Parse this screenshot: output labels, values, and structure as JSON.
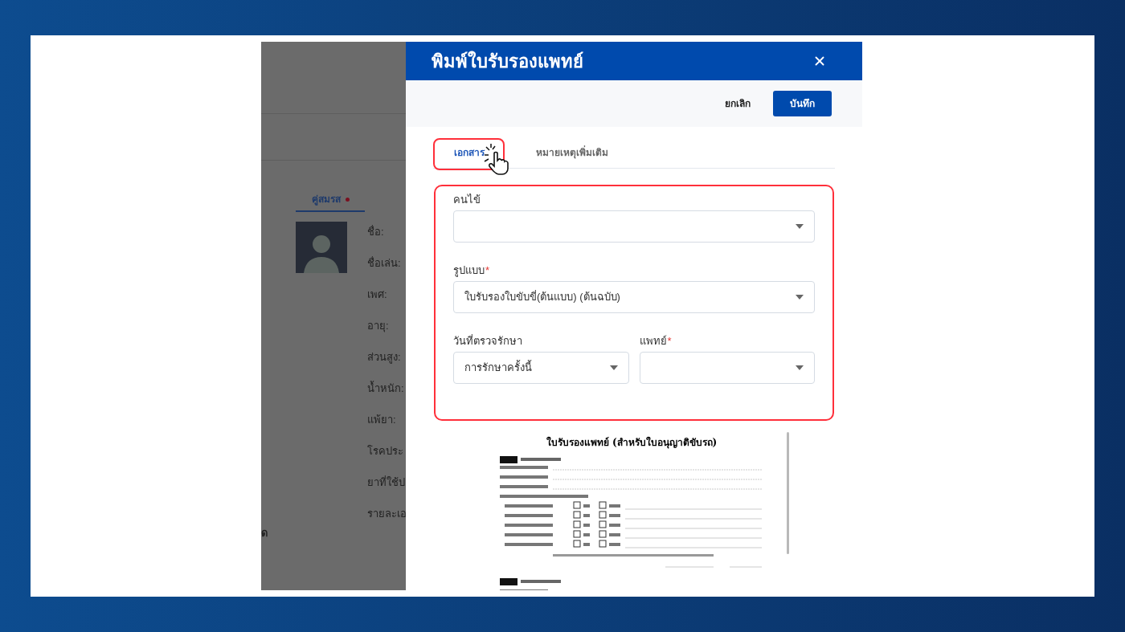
{
  "background_page": {
    "tab": {
      "label": "คู่สมรส",
      "selected": true
    },
    "profile_labels": [
      "ชื่อ:",
      "ชื่อเล่น:",
      "เพศ:",
      "อายุ:",
      "ส่วนสูง:",
      "น้ำหนัก:",
      "แพ้ยา:",
      "โรคประ",
      "ยาที่ใช้ป",
      "รายละเอ"
    ],
    "cut_text": "ด"
  },
  "dialog": {
    "title": "พิมพ์ใบรับรองแพทย์",
    "required_mark": "*",
    "actions": [
      {
        "label": "ยกเลิก",
        "kind": "text"
      },
      {
        "label": "บันทึก",
        "kind": "primary"
      }
    ],
    "tabs": [
      {
        "label": "เอกสาร",
        "selected": true,
        "highlighted": true
      },
      {
        "label": "หมายเหตุเพิ่มเติม",
        "selected": false,
        "highlighted": false
      }
    ],
    "fields": [
      {
        "label": "คนไข้",
        "required": false,
        "kind": "full"
      },
      {
        "label": "รูปแบบ",
        "required": true,
        "kind": "full",
        "value": "ใบรับรองใบขับขี่(ต้นแบบ) (ต้นฉบับ)"
      },
      {
        "label": "วันที่ตรวจรักษา",
        "required": false,
        "kind": "half",
        "value": "การรักษาครั้งนี้"
      },
      {
        "label": "แพทย์",
        "required": true,
        "kind": "half"
      }
    ],
    "preview": {
      "title": "ใบรับรองแพทย์ (สำหรับใบอนุญาติขับรถ)"
    }
  }
}
